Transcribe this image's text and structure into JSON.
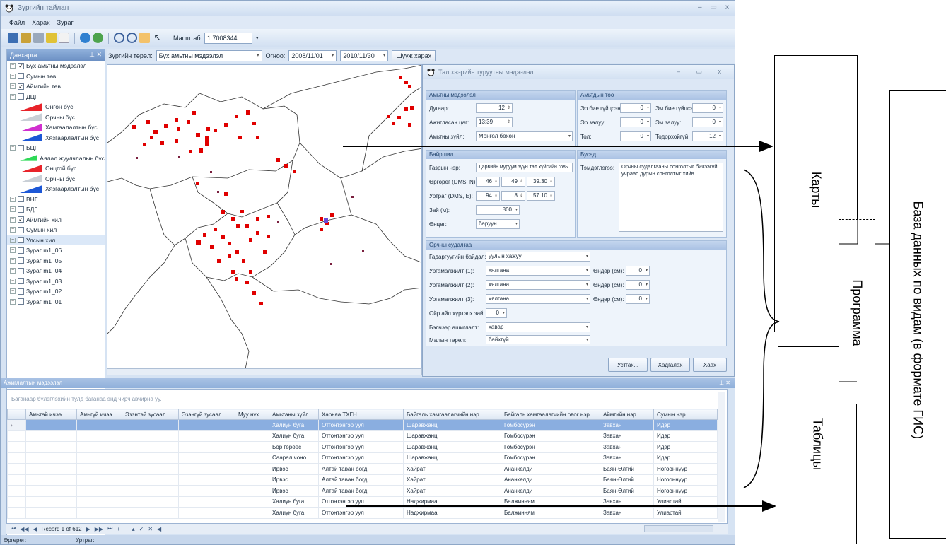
{
  "window": {
    "title": "Зүргийн тайлан",
    "controls": [
      "–",
      "▭",
      "x"
    ]
  },
  "menu": [
    "Файл",
    "Харах",
    "Зураг"
  ],
  "toolbar": {
    "scale_label": "Масштаб:",
    "scale_value": "1:7008344"
  },
  "layers_panel": {
    "title": "Давхарга",
    "items": [
      {
        "label": "Бүх амьтны мэдээлэл",
        "checked": true
      },
      {
        "label": "Сумын төв",
        "checked": false
      },
      {
        "label": "Аймгийн төв",
        "checked": true
      },
      {
        "label": "ДЦГ",
        "checked": false
      }
    ],
    "dcg_sub": [
      {
        "label": "Онгон бүс",
        "color": "#e8232a"
      },
      {
        "label": "Орчны бүс",
        "color": "#c9cfd6"
      },
      {
        "label": "Хамгаалалтын бүс",
        "color": "#d12fcf"
      },
      {
        "label": "Хязгаарлалтын бүс",
        "color": "#1c57d6"
      }
    ],
    "bcg": {
      "label": "БЦГ",
      "checked": false
    },
    "bcg_sub": [
      {
        "label": "Аялал жуулчлалын бүс",
        "color": "#2ed957"
      },
      {
        "label": "Онцгой бүс",
        "color": "#e8232a"
      },
      {
        "label": "Орчны бүс",
        "color": "#c9cfd6"
      },
      {
        "label": "Хязгаарлалтын бүс",
        "color": "#1c57d6"
      }
    ],
    "more": [
      {
        "label": "ВНГ",
        "checked": false
      },
      {
        "label": "БДГ",
        "checked": false
      },
      {
        "label": "Аймгийн хил",
        "checked": true
      },
      {
        "label": "Сумын хил",
        "checked": false
      },
      {
        "label": "Улсын хил",
        "checked": false
      },
      {
        "label": "Зураг m1_06",
        "checked": false
      },
      {
        "label": "Зураг m1_05",
        "checked": false
      },
      {
        "label": "Зураг m1_04",
        "checked": false
      },
      {
        "label": "Зураг m1_03",
        "checked": false
      },
      {
        "label": "Зураг m1_02",
        "checked": false
      },
      {
        "label": "Зураг m1_01",
        "checked": false
      }
    ]
  },
  "filter": {
    "type_label": "Зүргийн төрөл:",
    "type_value": "Бүх амьтны мэдээлэл",
    "date_label": "Огноо:",
    "date_from": "2008/11/01",
    "date_to": "2010/11/30",
    "search_button": "Шүүж харах"
  },
  "dialog": {
    "title": "Тал хээрийн туруутны мэдээлэл",
    "animal": {
      "title": "Амьтны мэдээлэл",
      "id_label": "Дугаар:",
      "id_value": "12",
      "time_label": "Ажигласан цаг:",
      "time_value": "13:39",
      "species_label": "Амьтны зүйл:",
      "species_value": "Монгол бөхөн"
    },
    "count": {
      "title": "Амьтдын тоо",
      "f1_label": "Эр бие гүйцсэн:",
      "f1_value": "0",
      "f2_label": "Эм бие гүйцсэн:",
      "f2_value": "0",
      "f3_label": "Эр залуу:",
      "f3_value": "0",
      "f4_label": "Эм залуу:",
      "f4_value": "0",
      "f5_label": "Тол:",
      "f5_value": "0",
      "f6_label": "Тодорхойгүй:",
      "f6_value": "12"
    },
    "location": {
      "title": "Байршил",
      "place_label": "Газрын нэр:",
      "place_value": "Дарвийн муруум зүүн тал хүйсийн говь",
      "lat_label": "Өргөрөг (DMS, N):",
      "lat_d": "46",
      "lat_m": "49",
      "lat_s": "39.30",
      "lon_label": "Уртраг (DMS, E):",
      "lon_d": "94",
      "lon_m": "8",
      "lon_s": "57.10",
      "dist_label": "Зай (м):",
      "dist_value": "800",
      "dir_label": "Өнцөг:",
      "dir_value": "баруун"
    },
    "other": {
      "title": "Бусад",
      "note_label": "Тэмдэглэгээ:",
      "note_value": "Орчны судалгааны сонголтыг бичээгүй учраас дурын сонголтыг хийв."
    },
    "env": {
      "title": "Орчны судалгаа",
      "surface_label": "Гадаргуугийн байдал:",
      "surface_value": "уулын хажуу",
      "plant1_label": "Ургамалжилт (1):",
      "plant1_value": "хялгана",
      "plant2_label": "Ургамалжилт (2):",
      "plant2_value": "хялгана",
      "plant3_label": "Ургамалжилт (3):",
      "plant3_value": "хялгана",
      "height_label": "Өндөр (см):",
      "h1": "0",
      "h2": "0",
      "h3": "0",
      "near_label": "Ойр айл хүртэлх зай:",
      "near_value": "0",
      "pasture_label": "Бэлчээр ашиглалт:",
      "pasture_value": "хавар",
      "livestock_label": "Малын төрөл:",
      "livestock_value": "байхгүй"
    },
    "buttons": {
      "delete": "Устгах...",
      "save": "Хадгалах",
      "close": "Хаах"
    }
  },
  "observations": {
    "title": "Ажиглалтын мэдээлэл",
    "group_hint": "Баганаар бүлэглэхийн тулд баганаа энд чирч авчирна уу.",
    "columns": [
      "Амьтай ичээ",
      "Амьгүй ичээ",
      "Эзэнтэй зусаал",
      "Эзэнгүй зусаал",
      "Муу нүх",
      "Амьтаны зүйл",
      "Харьяа ТХГН",
      "Байгаль хамгаалагчийн нэр",
      "Байгаль хамгаалагчийн овог нэр",
      "Аймгийн нэр",
      "Сумын нэр"
    ],
    "rows": [
      [
        "",
        "",
        "",
        "",
        "",
        "Халиун буга",
        "Отгонтэнгэр уул",
        "Шаравжанц",
        "Гомбосүрэн",
        "Завхан",
        "Идэр"
      ],
      [
        "",
        "",
        "",
        "",
        "",
        "Халиун буга",
        "Отгонтэнгэр уул",
        "Шаравжанц",
        "Гомбосүрэн",
        "Завхан",
        "Идэр"
      ],
      [
        "",
        "",
        "",
        "",
        "",
        "Бор гөрөөс",
        "Отгонтэнгэр уул",
        "Шаравжанц",
        "Гомбосүрэн",
        "Завхан",
        "Идэр"
      ],
      [
        "",
        "",
        "",
        "",
        "",
        "Саарал чоно",
        "Отгонтэнгэр уул",
        "Шаравжанц",
        "Гомбосүрэн",
        "Завхан",
        "Идэр"
      ],
      [
        "",
        "",
        "",
        "",
        "",
        "Ирвэс",
        "Алтай таван богд",
        "Хайрат",
        "Ананкелди",
        "Баян-Өлгий",
        "Ногооннуур"
      ],
      [
        "",
        "",
        "",
        "",
        "",
        "Ирвэс",
        "Алтай таван богд",
        "Хайрат",
        "Ананкелди",
        "Баян-Өлгий",
        "Ногооннуур"
      ],
      [
        "",
        "",
        "",
        "",
        "",
        "Ирвэс",
        "Алтай таван богд",
        "Хайрат",
        "Ананкелди",
        "Баян-Өлгий",
        "Ногооннуур"
      ],
      [
        "",
        "",
        "",
        "",
        "",
        "Халиун буга",
        "Отгонтэнгэр уул",
        "Наджирмаа",
        "Балжинням",
        "Завхан",
        "Улиастай"
      ],
      [
        "",
        "",
        "",
        "",
        "",
        "Халиун буга",
        "Отгонтэнгэр уул",
        "Наджирмаа",
        "Балжинням",
        "Завхан",
        "Улиастай"
      ]
    ],
    "record_text": "Record 1 of 612"
  },
  "statusbar": {
    "lat_label": "Өргөрөг:",
    "lon_label": "Уртраг:"
  },
  "annotations": {
    "maps": "Карты",
    "program": "Программа",
    "tables": "Таблицы",
    "database": "База данных по видам (в формате ГИС)"
  }
}
